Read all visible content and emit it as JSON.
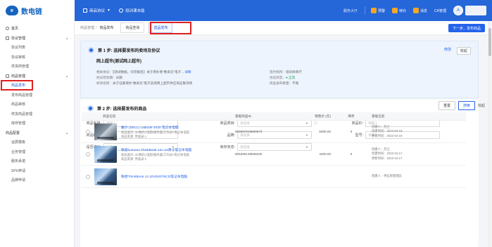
{
  "app": {
    "logo_mark": "e",
    "logo_text": "数电链",
    "nav": [
      {
        "label": "商品协议"
      },
      {
        "label": "培训课本能"
      }
    ],
    "right_link": "服务大厅",
    "icons": [
      {
        "label": "预警"
      },
      {
        "label": "待办"
      },
      {
        "label": "消息"
      }
    ],
    "ca_label": "CA管理",
    "avatar_letter": "A"
  },
  "sidebar": {
    "items": [
      {
        "label": "首页",
        "type": "group"
      },
      {
        "label": "协议管理",
        "type": "group",
        "arrow": "▲"
      },
      {
        "label": "协议列表",
        "type": "child"
      },
      {
        "label": "协议审核",
        "type": "child"
      },
      {
        "label": "供货商管理",
        "type": "child"
      },
      {
        "label": "商品管理",
        "type": "group",
        "arrow": "▲"
      },
      {
        "label": "商品发布",
        "type": "child",
        "active": true
      },
      {
        "label": "发布商品管理",
        "type": "child"
      },
      {
        "label": "商品审核",
        "type": "child"
      },
      {
        "label": "供货商品管理",
        "type": "child"
      },
      {
        "label": "库存管理",
        "type": "child"
      },
      {
        "label": "商品配置",
        "type": "group",
        "arrow": "▲"
      },
      {
        "label": "运费模板",
        "type": "child"
      },
      {
        "label": "业务管理",
        "type": "child"
      },
      {
        "label": "服务承诺",
        "type": "child"
      },
      {
        "label": "SPU申请",
        "type": "child"
      },
      {
        "label": "品牌申请",
        "type": "child"
      }
    ]
  },
  "breadcrumb": {
    "parent": "商品管理",
    "current": "商品发布"
  },
  "tabs": [
    {
      "label": "商品查询",
      "active": false
    },
    {
      "label": "选品发布",
      "active": true
    }
  ],
  "next_button": "下一步，发布商品",
  "step1": {
    "title": "第 1 步: 选择要发布的卖场及协议",
    "edit": "修改",
    "collapse": "收起",
    "project": "网上超市(测试网上超市)",
    "rows": [
      {
        "left_key": "相关协议：",
        "left_val": "【测试数据，切勿报名】关于增补者“数采云”电子... ",
        "left_link": "详情",
        "right_key": "签约机构：",
        "right_val": "培训财政厅"
      },
      {
        "left_key": "协议有效期：",
        "left_val": "长期",
        "right_key": "协议状态：",
        "right_val": "● 正常"
      },
      {
        "left_key": "标项名称：",
        "left_val": "关于征集增补“数采云”电子卖场网上超市供应商征集项目",
        "right_key": "商品发布数量：",
        "right_val": "不限"
      }
    ]
  },
  "step2": {
    "title": "第 2 步: 选择要发布的商品",
    "filters": {
      "name_label": "商品名称:",
      "name_ph": "请输入",
      "category_label": "商品类目:",
      "category_ph": "请选择",
      "id_label": "商品ID:",
      "id_ph": "请输入",
      "code_label": "商品编码:",
      "code_ph": "请输入",
      "brand_label": "品牌:",
      "brand_ph": "请选择",
      "model_label": "型号:",
      "model_ph": "请输入",
      "channel_label": "是否进口:",
      "channel_ph": "请选择",
      "stock_label": "库存状态:",
      "stock_ph": "请选择"
    },
    "tools": {
      "reset": "重置",
      "search": "搜索",
      "collapse": "收起"
    },
    "columns": [
      "商品信息",
      "基础商品ID",
      "销售价 (元)",
      "库存",
      "基础信息"
    ],
    "rows": [
      {
        "name": "戴尔 (DELL) Latitude 3420 笔记本电脑",
        "cat": "商品类目: 3C数码>电脑/服务器/工作站>笔记本电脑",
        "src": "商品来源: 界面录入",
        "id": "906597619560573",
        "price": "5000.00",
        "stock": "0",
        "creator": "创建人：苏兰",
        "created": "创建时间：2022-04-18",
        "updated": "更新时间：2022-04-18"
      },
      {
        "name": "联想/Lenovo ThinkBook 14+ 14英寸笔记本电脑",
        "cat": "商品类目: 3C数码>电脑/服务器/工作站>笔记本电脑",
        "src": "商品来源: 界面录入",
        "id": "905308139538425",
        "price": "4200.00",
        "stock": "0",
        "creator": "创建人：苏兰",
        "created": "创建时间：2022-04-17",
        "updated": "更新时间：2022-04-17"
      },
      {
        "name": "联想ThinkBook 14 20VD00T8CD笔记本电脑",
        "cat": "",
        "src": "",
        "id": "",
        "price": "",
        "stock": "",
        "creator": "创建人：供应商管理员",
        "created": "",
        "updated": ""
      }
    ]
  }
}
